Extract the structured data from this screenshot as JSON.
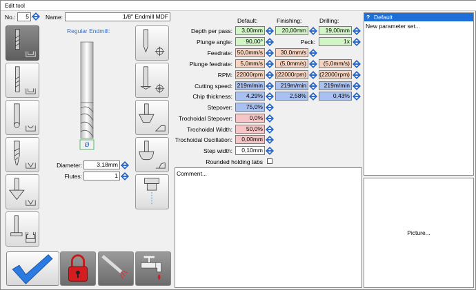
{
  "window": {
    "title": "Edit tool"
  },
  "tool": {
    "no_label": "No.:",
    "no_value": "5",
    "name_label": "Name:",
    "name_value": "1/8\" Endmill MDF",
    "type_label": "Regular Endmill:",
    "diameter_label": "Diameter:",
    "diameter_value": "3,18mm",
    "flutes_label": "Flutes:",
    "flutes_value": "1",
    "diameter_symbol": "Ø"
  },
  "columns": {
    "default": "Default:",
    "finishing": "Finishing:",
    "drilling": "Drilling:"
  },
  "params": {
    "depth": {
      "label": "Depth per pass:",
      "default": "3,00mm",
      "finishing": "20,00mm",
      "drilling": "19,00mm"
    },
    "plunge_angle": {
      "label": "Plunge angle:",
      "default": "90,00°",
      "peck_label": "Peck:",
      "peck_value": "1x"
    },
    "feedrate": {
      "label": "Feedrate:",
      "default": "50,0mm/s",
      "finishing": "30,0mm/s"
    },
    "plunge_feedrate": {
      "label": "Plunge feedrate:",
      "default": "5,0mm/s",
      "finishing": "(5,0mm/s)",
      "drilling": "(5,0mm/s)"
    },
    "rpm": {
      "label": "RPM:",
      "default": "22000rpm",
      "finishing": "(22000rpm)",
      "drilling": "(22000rpm)"
    },
    "cutting_speed": {
      "label": "Cutting speed:",
      "default": "219m/min",
      "finishing": "219m/min",
      "drilling": "219m/min"
    },
    "chip_thickness": {
      "label": "Chip thickness:",
      "default": "4,29%",
      "finishing": "2,58%",
      "drilling": "0,43%"
    },
    "stepover": {
      "label": "Stepover:",
      "default": "75,0%"
    },
    "troch_stepover": {
      "label": "Trochoidal Stepover:",
      "default": "0,0%"
    },
    "troch_width": {
      "label": "Trochoidal Width:",
      "default": "50,0%"
    },
    "troch_osc": {
      "label": "Trochoidal Oscillation:",
      "default": "0,00mm"
    },
    "step_width": {
      "label": "Step width:",
      "default": "0,10mm"
    },
    "rounded_tabs": {
      "label": "Rounded holding tabs"
    }
  },
  "comment": {
    "text": "Comment..."
  },
  "parameter_sets": {
    "selected": "Default",
    "selected_icon": "?",
    "new_item": "New parameter set..."
  },
  "picture": {
    "text": "Picture..."
  },
  "colors": {
    "selected_row": "#1f6fd8",
    "green_field": "#d2f5c6",
    "orange_field": "#f8d4c0",
    "blue_field": "#a9c1f0",
    "pink_field": "#f6c6c6",
    "spin_blue": "#2a6fd8"
  }
}
